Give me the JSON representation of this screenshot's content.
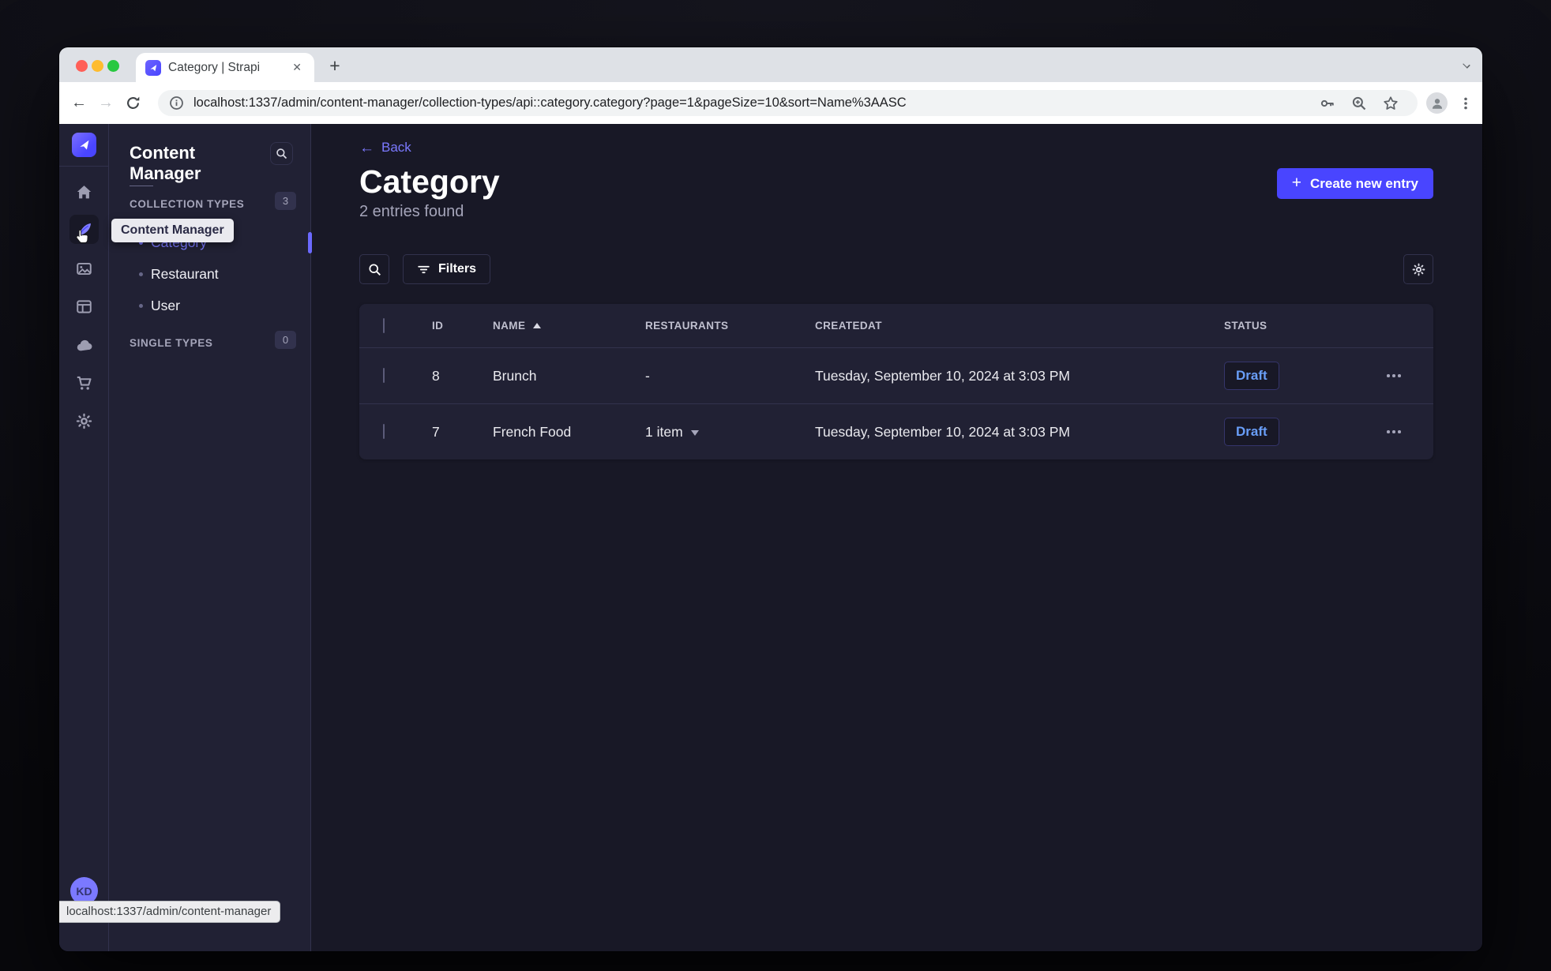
{
  "colors": {
    "brand_primary": "#4945ff",
    "link": "#7b79ff",
    "page_background": "#181826",
    "surface": "#212134",
    "border": "#32324d",
    "text_muted": "#a5a5ba",
    "draft_status_text": "#699ef8",
    "traffic_lights": [
      "#ff5f57",
      "#febc2e",
      "#28c840"
    ]
  },
  "browser": {
    "tab_title": "Category | Strapi",
    "url": "localhost:1337/admin/content-manager/collection-types/api::category.category?page=1&pageSize=10&sort=Name%3AASC",
    "link_preview": "localhost:1337/admin/content-manager",
    "toolbar_icons": [
      "back",
      "forward",
      "reload",
      "info",
      "password-key",
      "zoom",
      "bookmark-star",
      "profile",
      "menu"
    ]
  },
  "sidebar": {
    "tooltip": "Content Manager",
    "avatar_initials": "KD",
    "icons": [
      "strapi-logo",
      "home",
      "content-manager",
      "media-library",
      "content-type-builder",
      "marketplace",
      "purchases",
      "settings"
    ]
  },
  "subnav": {
    "title": "Content Manager",
    "sections": [
      {
        "label": "COLLECTION TYPES",
        "badge": "3"
      },
      {
        "label": "SINGLE TYPES",
        "badge": "0"
      }
    ],
    "collection_items": [
      {
        "label": "Category",
        "active": true
      },
      {
        "label": "Restaurant",
        "active": false
      },
      {
        "label": "User",
        "active": false
      }
    ]
  },
  "main": {
    "back_label": "Back",
    "title": "Category",
    "subtitle": "2 entries found",
    "create_button_label": "Create new entry",
    "filters_button_label": "Filters",
    "table": {
      "columns": [
        "ID",
        "NAME",
        "RESTAURANTS",
        "CREATEDAT",
        "STATUS"
      ],
      "sorted_column": "NAME",
      "sort_direction": "asc",
      "rows": [
        {
          "id": "8",
          "name": "Brunch",
          "restaurants": "-",
          "has_items_dropdown": false,
          "createdat": "Tuesday, September 10, 2024 at 3:03 PM",
          "status": "Draft"
        },
        {
          "id": "7",
          "name": "French Food",
          "restaurants": "1 item",
          "has_items_dropdown": true,
          "createdat": "Tuesday, September 10, 2024 at 3:03 PM",
          "status": "Draft"
        }
      ]
    }
  }
}
